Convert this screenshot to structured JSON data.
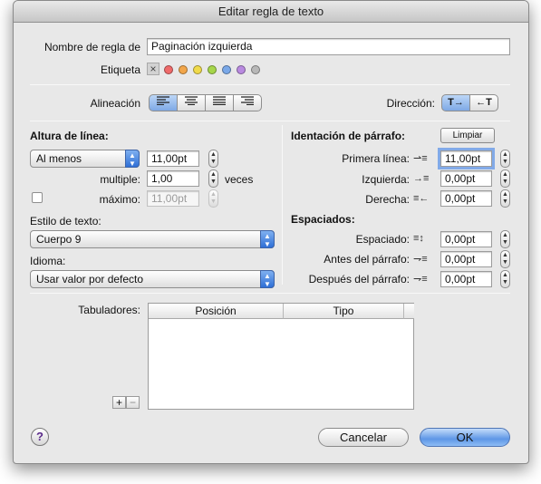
{
  "window": {
    "title": "Editar regla de texto"
  },
  "rule": {
    "name_label": "Nombre de regla de",
    "name_value": "Paginación izquierda"
  },
  "tag": {
    "label": "Etiqueta",
    "none_symbol": "×",
    "colors": [
      "#ef6a6a",
      "#f2a64a",
      "#f0da4a",
      "#a6d64a",
      "#7aa8e8",
      "#b98ae0",
      "#b8b8b8"
    ]
  },
  "alignment": {
    "label": "Alineación",
    "options": [
      "left",
      "center",
      "justify",
      "right"
    ],
    "selected": "left"
  },
  "direction": {
    "label": "Dirección:",
    "ltr": "T→",
    "rtl": "←T",
    "selected": "ltr"
  },
  "line_height": {
    "heading": "Altura de línea:",
    "mode": "Al menos",
    "value": "11,00pt",
    "multiple_label": "multiple:",
    "multiple_value": "1,00",
    "times": "veces",
    "max_label": "máximo:",
    "max_value": "11,00pt"
  },
  "text_style": {
    "label": "Estilo de texto:",
    "value": "Cuerpo 9"
  },
  "language": {
    "label": "Idioma:",
    "value": "Usar valor por defecto"
  },
  "indent": {
    "heading": "Identación de párrafo:",
    "clear": "Limpiar",
    "first_label": "Primera línea:",
    "first_value": "11,00pt",
    "left_label": "Izquierda:",
    "left_value": "0,00pt",
    "right_label": "Derecha:",
    "right_value": "0,00pt"
  },
  "spacing": {
    "heading": "Espaciados:",
    "line_label": "Espaciado:",
    "line_value": "0,00pt",
    "before_label": "Antes del párrafo:",
    "before_value": "0,00pt",
    "after_label": "Después del párrafo:",
    "after_value": "0,00pt"
  },
  "tabs": {
    "label": "Tabuladores:",
    "columns": [
      "Posición",
      "Tipo"
    ],
    "add": "+",
    "remove": "−"
  },
  "buttons": {
    "help": "?",
    "cancel": "Cancelar",
    "ok": "OK"
  },
  "glyphs": {
    "stepper": "▲\n▼",
    "popup_arrow": "▲\n▼"
  }
}
